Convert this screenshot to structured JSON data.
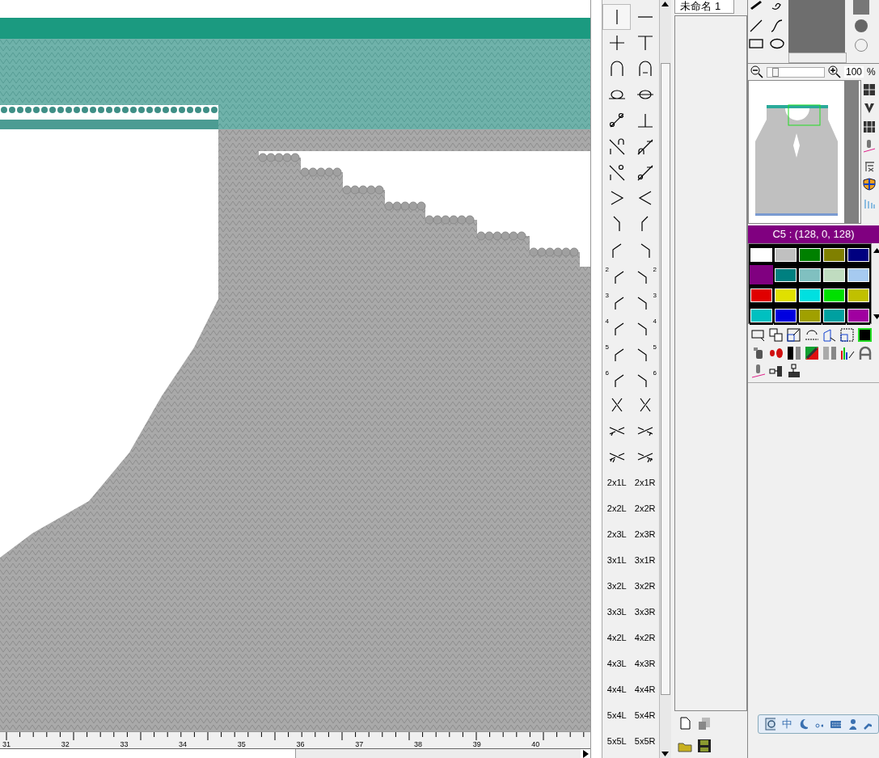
{
  "symbols": [
    {
      "kind": "glyph",
      "selected": true
    },
    {
      "kind": "glyph",
      "selected": false
    },
    {
      "kind": "glyph",
      "selected": false
    },
    {
      "kind": "glyph",
      "selected": false
    },
    {
      "kind": "glyph",
      "selected": false
    },
    {
      "kind": "glyph",
      "selected": false
    },
    {
      "kind": "glyph",
      "selected": false
    },
    {
      "kind": "glyph",
      "selected": false
    },
    {
      "kind": "glyph",
      "selected": false
    },
    {
      "kind": "glyph",
      "selected": false
    },
    {
      "kind": "glyph",
      "selected": false
    },
    {
      "kind": "glyph",
      "selected": false
    },
    {
      "kind": "glyph",
      "selected": false
    },
    {
      "kind": "glyph",
      "selected": false
    },
    {
      "kind": "glyph",
      "selected": false
    },
    {
      "kind": "glyph",
      "selected": false
    },
    {
      "kind": "glyph",
      "selected": false
    },
    {
      "kind": "glyph",
      "selected": false
    },
    {
      "kind": "glyph",
      "selected": false
    },
    {
      "kind": "glyph",
      "selected": false
    },
    {
      "kind": "numbered",
      "label": "2",
      "selected": false
    },
    {
      "kind": "numbered",
      "label": "2",
      "selected": false
    },
    {
      "kind": "numbered",
      "label": "3",
      "selected": false
    },
    {
      "kind": "numbered",
      "label": "3",
      "selected": false
    },
    {
      "kind": "numbered",
      "label": "4",
      "selected": false
    },
    {
      "kind": "numbered",
      "label": "4",
      "selected": false
    },
    {
      "kind": "numbered",
      "label": "5",
      "selected": false
    },
    {
      "kind": "numbered",
      "label": "5",
      "selected": false
    },
    {
      "kind": "numbered",
      "label": "6",
      "selected": false
    },
    {
      "kind": "numbered",
      "label": "6",
      "selected": false
    },
    {
      "kind": "glyph",
      "selected": false
    },
    {
      "kind": "glyph",
      "selected": false
    },
    {
      "kind": "glyph",
      "selected": false
    },
    {
      "kind": "glyph",
      "selected": false
    },
    {
      "kind": "glyph",
      "selected": false
    },
    {
      "kind": "glyph",
      "selected": false
    },
    {
      "kind": "text",
      "label": "2x1L",
      "selected": false
    },
    {
      "kind": "text",
      "label": "2x1R",
      "selected": false
    },
    {
      "kind": "text",
      "label": "2x2L",
      "selected": false
    },
    {
      "kind": "text",
      "label": "2x2R",
      "selected": false
    },
    {
      "kind": "text",
      "label": "2x3L",
      "selected": false
    },
    {
      "kind": "text",
      "label": "2x3R",
      "selected": false
    },
    {
      "kind": "text",
      "label": "3x1L",
      "selected": false
    },
    {
      "kind": "text",
      "label": "3x1R",
      "selected": false
    },
    {
      "kind": "text",
      "label": "3x2L",
      "selected": false
    },
    {
      "kind": "text",
      "label": "3x2R",
      "selected": false
    },
    {
      "kind": "text",
      "label": "3x3L",
      "selected": false
    },
    {
      "kind": "text",
      "label": "3x3R",
      "selected": false
    },
    {
      "kind": "text",
      "label": "4x2L",
      "selected": false
    },
    {
      "kind": "text",
      "label": "4x2R",
      "selected": false
    },
    {
      "kind": "text",
      "label": "4x3L",
      "selected": false
    },
    {
      "kind": "text",
      "label": "4x3R",
      "selected": false
    },
    {
      "kind": "text",
      "label": "4x4L",
      "selected": false
    },
    {
      "kind": "text",
      "label": "4x4R",
      "selected": false
    },
    {
      "kind": "text",
      "label": "5x4L",
      "selected": false
    },
    {
      "kind": "text",
      "label": "5x4R",
      "selected": false
    },
    {
      "kind": "text",
      "label": "5x5L",
      "selected": false
    },
    {
      "kind": "text",
      "label": "5x5R",
      "selected": false
    }
  ],
  "ruler": {
    "labels": [
      "31",
      "32",
      "33",
      "34",
      "35",
      "36",
      "37",
      "38",
      "39",
      "40"
    ]
  },
  "tab": {
    "label": "未命名 1"
  },
  "zoom": {
    "value": "100",
    "unit": "%",
    "level": 0.1
  },
  "palette": {
    "title": "C5 : (128, 0, 128)",
    "colors": [
      {
        "color": "#ffffff",
        "selected": false
      },
      {
        "color": "#c0c0c0",
        "selected": false
      },
      {
        "color": "#008000",
        "selected": false
      },
      {
        "color": "#808000",
        "selected": false
      },
      {
        "color": "#000080",
        "selected": false
      },
      {
        "color": "#800080",
        "selected": true
      },
      {
        "color": "#008080",
        "selected": false
      },
      {
        "color": "#80c0c0",
        "selected": false
      },
      {
        "color": "#c0dcc0",
        "selected": false
      },
      {
        "color": "#a6caf0",
        "selected": false
      },
      {
        "color": "#e00000",
        "selected": false
      },
      {
        "color": "#e0e000",
        "selected": false
      },
      {
        "color": "#00e0e0",
        "selected": false
      },
      {
        "color": "#00e000",
        "selected": false
      },
      {
        "color": "#c0c000",
        "selected": false
      },
      {
        "color": "#00c0c0",
        "selected": false
      },
      {
        "color": "#0000e0",
        "selected": false
      },
      {
        "color": "#a0a000",
        "selected": false
      },
      {
        "color": "#00a0a0",
        "selected": false
      },
      {
        "color": "#a000a0",
        "selected": false
      }
    ]
  },
  "ime": {
    "label": "中"
  }
}
